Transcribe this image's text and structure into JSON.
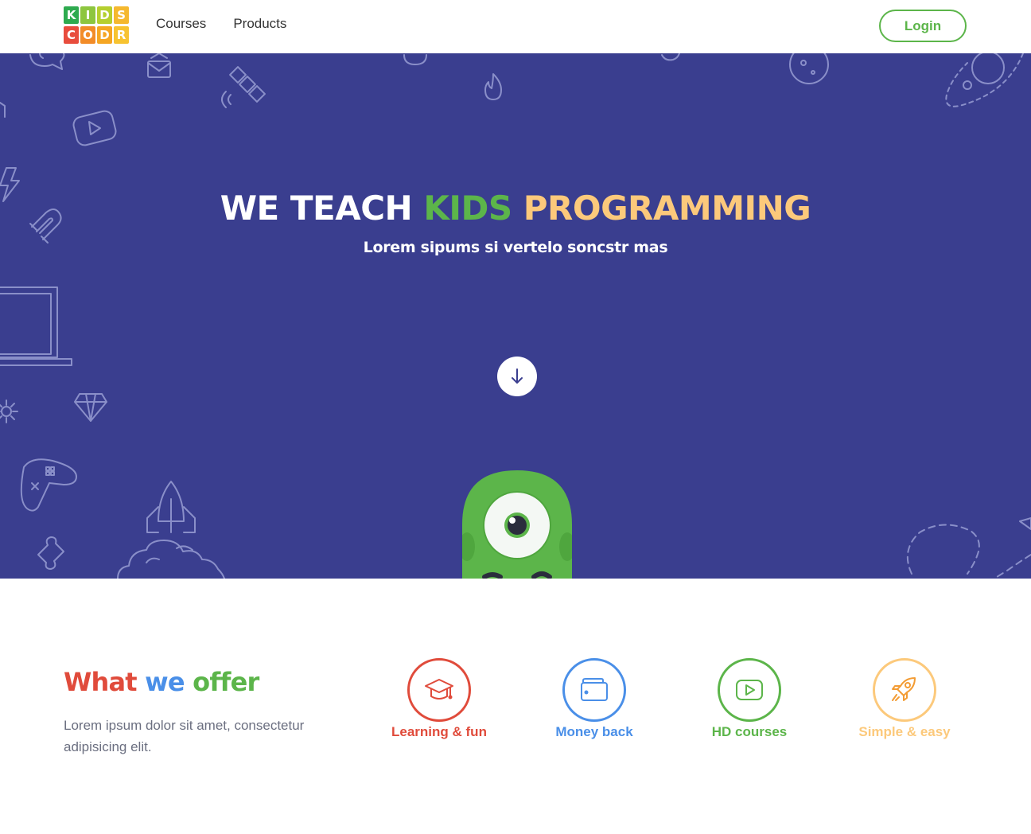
{
  "colors": {
    "hero_bg": "#3a3e8f",
    "green": "#5cb54a",
    "red": "#e04b3b",
    "blue": "#4a8fe8",
    "yellow": "#fcc97b",
    "orange": "#f39c34"
  },
  "header": {
    "logo": {
      "letters": [
        "K",
        "I",
        "D",
        "S",
        "C",
        "O",
        "D",
        "R"
      ],
      "colors": [
        "#2eaa4f",
        "#8dc63f",
        "#b5cf2f",
        "#f5b82e",
        "#e84c3d",
        "#f28c28",
        "#f5a623",
        "#f7c331"
      ]
    },
    "nav": [
      "Courses",
      "Products"
    ],
    "login_label": "Login"
  },
  "hero": {
    "title_white": "WE TEACH ",
    "title_green": "KIDS ",
    "title_yellow": "PROGRAMMING",
    "subtitle": "Lorem sipums si vertelo soncstr mas",
    "scroll_icon": "arrow-down-icon",
    "background_icons": [
      "chat-bubble-icon",
      "envelope-icon",
      "satellite-icon",
      "flame-icon",
      "planet-icon",
      "play-button-icon",
      "lightning-icon",
      "magnet-icon",
      "laptop-icon",
      "gear-icon",
      "diamond-icon",
      "gamepad-icon",
      "rocket-icon",
      "puzzle-icon",
      "cloud-icon",
      "paper-plane-icon"
    ]
  },
  "offer": {
    "title_w1": "What ",
    "title_w2": "we ",
    "title_w3": "offer",
    "text": "Lorem ipsum dolor sit amet, consectetur adipisicing elit.",
    "features": [
      {
        "label": "Learning & fun",
        "icon": "graduation-cap-icon",
        "color": "#e04b3b"
      },
      {
        "label": "Money back",
        "icon": "wallet-icon",
        "color": "#4a8fe8"
      },
      {
        "label": "HD courses",
        "icon": "play-icon",
        "color": "#5cb54a"
      },
      {
        "label": "Simple & easy",
        "icon": "rocket-icon",
        "color": "#fcc97b"
      }
    ]
  }
}
